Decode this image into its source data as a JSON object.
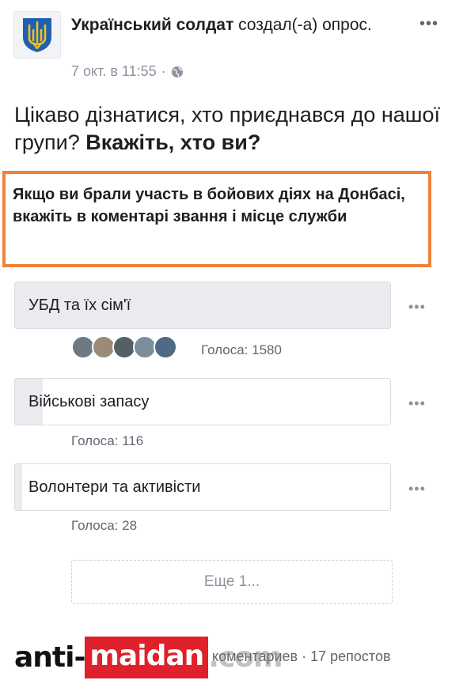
{
  "post": {
    "author": "Український солдат",
    "action": "создал(-а) опрос.",
    "timestamp": "7 окт. в 11:55",
    "separator": "·",
    "privacy_icon": "globe-icon",
    "question_regular": "Цікаво дізнатися, хто приєднався до нашої групи?",
    "question_bold": "Вкажіть, хто ви?",
    "highlighted_note": "Якщо ви брали участь в бойових діях на Донбасі, вкажіть в коментарі звання і місце служби",
    "highlight_color": "#f0813a"
  },
  "poll": {
    "options": [
      {
        "label": "УБД та їх сім'ї",
        "votes_text": "Голоса: 1580",
        "votes": 1580,
        "fill_fraction": 1.0
      },
      {
        "label": "Військові запасу",
        "votes_text": "Голоса: 116",
        "votes": 116,
        "fill_fraction": 0.073
      },
      {
        "label": "Волонтери та активісти",
        "votes_text": "Голоса: 28",
        "votes": 28,
        "fill_fraction": 0.018
      }
    ],
    "see_more": "Еще 1...",
    "more_icon": "ellipsis-icon"
  },
  "footer": {
    "stats_visible": "коментариев · 17 репостов"
  },
  "watermark": {
    "part1": "anti-",
    "part2": "maidan",
    "part3": ".com"
  }
}
